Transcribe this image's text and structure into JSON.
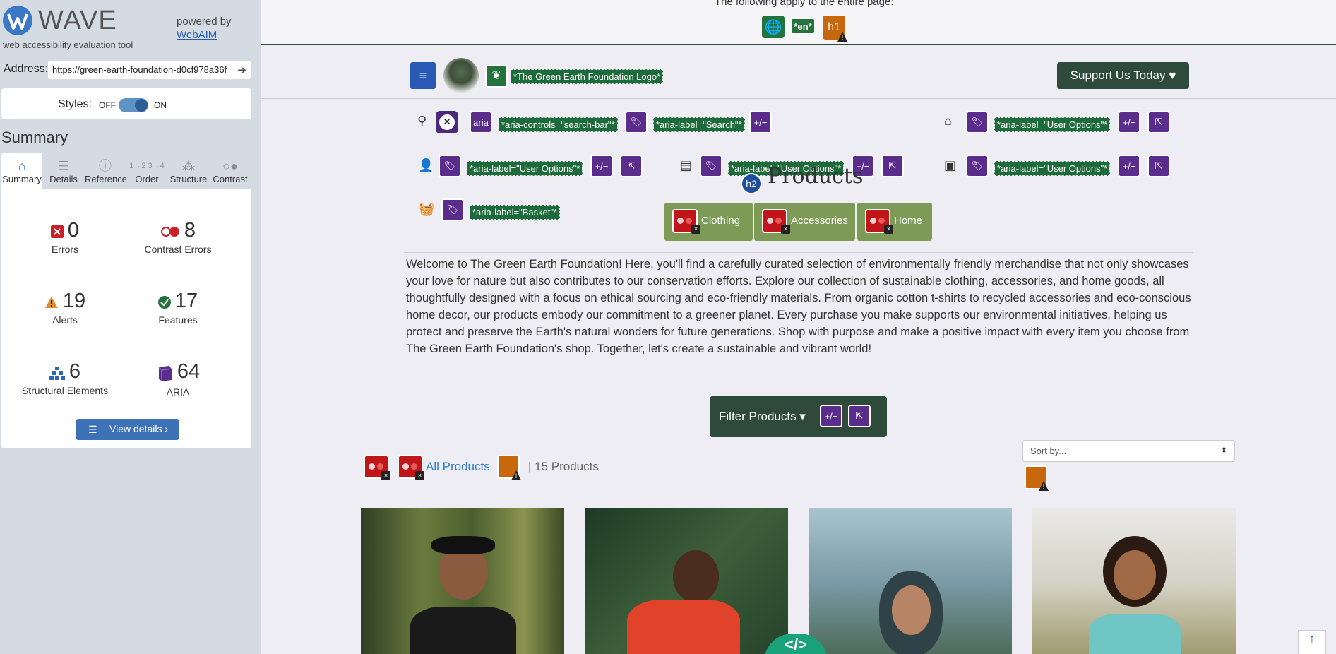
{
  "wave": {
    "title": "WAVE",
    "subtitle": "web accessibility evaluation tool",
    "powered_by": "powered by",
    "webaim_link": "WebAIM",
    "address_label": "Address:",
    "address_value": "https://green-earth-foundation-d0cf978a36f",
    "styles_label": "Styles:",
    "styles_off": "OFF",
    "styles_on": "ON",
    "summary_heading": "Summary",
    "tabs": [
      {
        "label": "Summary",
        "icon": "home-icon"
      },
      {
        "label": "Details",
        "icon": "list-icon"
      },
      {
        "label": "Reference",
        "icon": "info-icon"
      },
      {
        "label": "Order",
        "icon": "order-icon"
      },
      {
        "label": "Structure",
        "icon": "structure-icon"
      },
      {
        "label": "Contrast",
        "icon": "contrast-icon"
      }
    ],
    "stats": {
      "errors": {
        "value": "0",
        "label": "Errors"
      },
      "contrast": {
        "value": "8",
        "label": "Contrast Errors"
      },
      "alerts": {
        "value": "19",
        "label": "Alerts"
      },
      "features": {
        "value": "17",
        "label": "Features"
      },
      "structural": {
        "value": "6",
        "label": "Structural Elements"
      },
      "aria": {
        "value": "64",
        "label": "ARIA"
      }
    },
    "view_details": "View details ›"
  },
  "page": {
    "apply_text": "The following apply to the entire page:",
    "lang_badge": "*en*",
    "h1_badge": "h1",
    "logo_alt": "*The Green Earth Foundation Logo*",
    "support_button": "Support Us Today ♥",
    "aria_tags": {
      "search_controls": "*aria-controls=\"search-bar\"*",
      "search_label": "*aria-label=\"Search\"*",
      "user_options_1": "*aria-label=\"User Options\"*",
      "user_options_2": "*aria-label=\"User Options\"*",
      "user_options_3": "*aria-label=\"User Options\"*",
      "user_options_4": "*aria-label=\"User Options\"*",
      "basket": "*aria-label=\"Basket\"*"
    },
    "aria_badge": "aria",
    "plusminus": "+/−",
    "h2_badge": "h2",
    "products_heading": "Products",
    "categories": [
      "Clothing",
      "Accessories",
      "Home"
    ],
    "welcome": "Welcome to The Green Earth Foundation! Here, you'll find a carefully curated selection of environmentally friendly merchandise that not only showcases your love for nature but also contributes to our conservation efforts. Explore our collection of sustainable clothing, accessories, and home goods, all thoughtfully designed with a focus on ethical sourcing and eco-friendly materials. From organic cotton t-shirts to recycled accessories and eco-conscious home decor, our products embody our commitment to a greener planet. Every purchase you make supports our environmental initiatives, helping us protect and preserve the Earth's natural wonders for future generations. Shop with purpose and make a positive impact with every item you choose from The Green Earth Foundation's shop. Together, let's create a sustainable and vibrant world!",
    "filter_button": "Filter Products ▾",
    "sort_placeholder": "Sort by...",
    "all_products": "All Products",
    "product_count": "| 15 Products",
    "code_badge": "</>",
    "colors": {
      "dark_green": "#2d4a3a",
      "olive": "#7e9a57",
      "wave_purple": "#5a2d8c",
      "wave_green": "#1d6b3a",
      "wave_red": "#c0161a",
      "link_blue": "#2a7fd4"
    }
  }
}
